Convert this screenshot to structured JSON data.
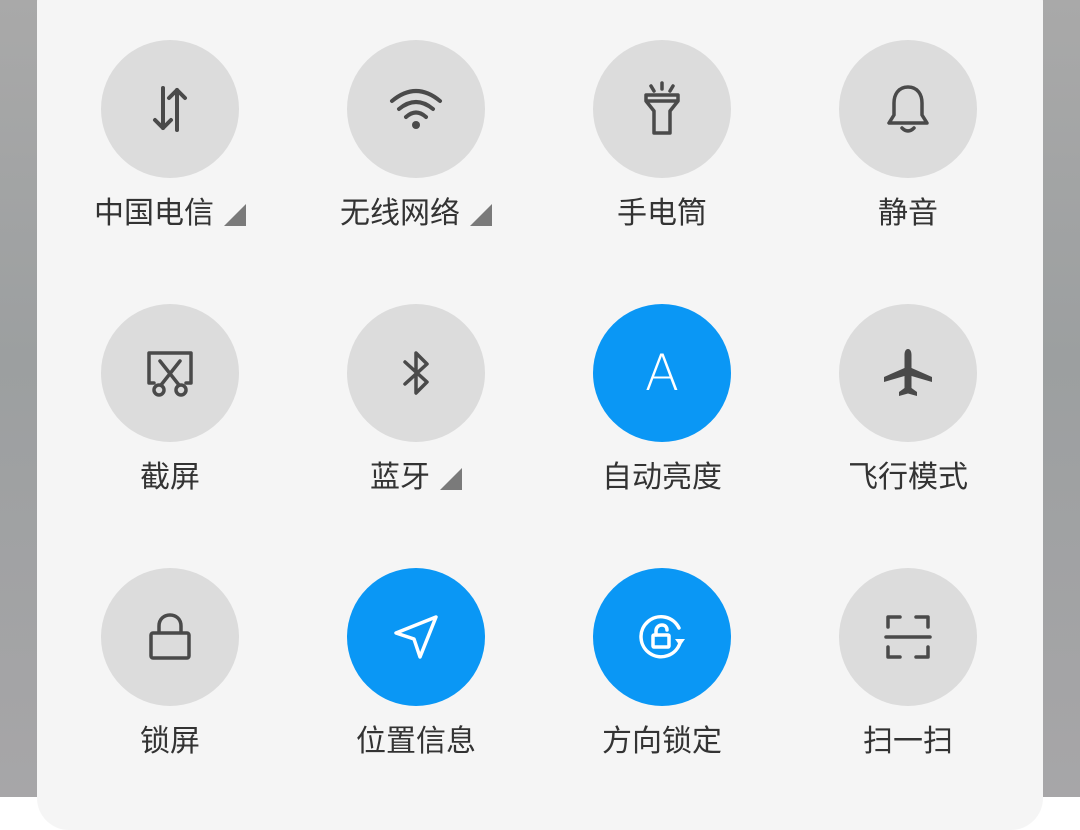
{
  "quick_settings": {
    "tiles": [
      {
        "label": "中国电信",
        "icon": "mobile-data-icon",
        "active": false,
        "has_submenu": true
      },
      {
        "label": "无线网络",
        "icon": "wifi-icon",
        "active": false,
        "has_submenu": true
      },
      {
        "label": "手电筒",
        "icon": "flashlight-icon",
        "active": false,
        "has_submenu": false
      },
      {
        "label": "静音",
        "icon": "bell-icon",
        "active": false,
        "has_submenu": false
      },
      {
        "label": "截屏",
        "icon": "screenshot-icon",
        "active": false,
        "has_submenu": false
      },
      {
        "label": "蓝牙",
        "icon": "bluetooth-icon",
        "active": false,
        "has_submenu": true
      },
      {
        "label": "自动亮度",
        "icon": "auto-brightness-icon",
        "active": true,
        "has_submenu": false,
        "glyph": "A"
      },
      {
        "label": "飞行模式",
        "icon": "airplane-icon",
        "active": false,
        "has_submenu": false
      },
      {
        "label": "锁屏",
        "icon": "lock-icon",
        "active": false,
        "has_submenu": false
      },
      {
        "label": "位置信息",
        "icon": "location-icon",
        "active": true,
        "has_submenu": false
      },
      {
        "label": "方向锁定",
        "icon": "rotation-lock-icon",
        "active": true,
        "has_submenu": false
      },
      {
        "label": "扫一扫",
        "icon": "scan-icon",
        "active": false,
        "has_submenu": false
      }
    ]
  },
  "colors": {
    "active": "#0a97f5",
    "inactive": "#dcdcdc",
    "icon": "#4a4a4a",
    "label": "#333333",
    "panel": "#f5f5f5"
  }
}
